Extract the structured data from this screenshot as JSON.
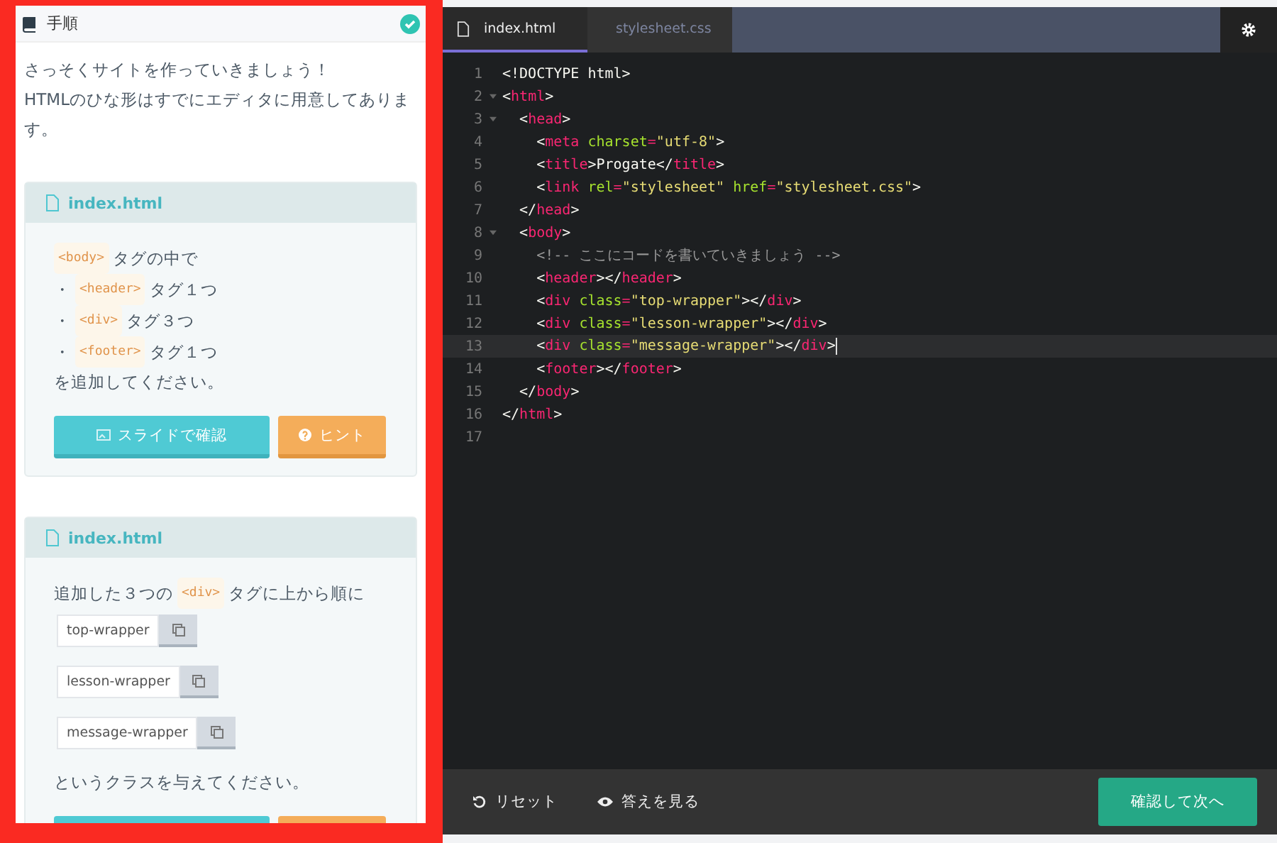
{
  "instructions": {
    "title": "手順",
    "completed": true,
    "intro": "さっそくサイトを作っていきましょう！\nHTMLのひな形はすでにエディタに用意してあります。",
    "cards": [
      {
        "file": "index.html",
        "lines": [
          [
            {
              "kind": "code",
              "text": "<body>"
            },
            {
              "kind": "text",
              "text": "タグの中で"
            }
          ],
          [
            {
              "kind": "text",
              "text": "・"
            },
            {
              "kind": "code",
              "text": "<header>"
            },
            {
              "kind": "text",
              "text": "タグ１つ"
            }
          ],
          [
            {
              "kind": "text",
              "text": "・"
            },
            {
              "kind": "code",
              "text": "<div>"
            },
            {
              "kind": "text",
              "text": "タグ３つ"
            }
          ],
          [
            {
              "kind": "text",
              "text": "・"
            },
            {
              "kind": "code",
              "text": "<footer>"
            },
            {
              "kind": "text",
              "text": "タグ１つ"
            }
          ],
          [
            {
              "kind": "text",
              "text": "を追加してください。"
            }
          ]
        ],
        "buttons": {
          "slide": "スライドで確認",
          "hint": "ヒント"
        }
      },
      {
        "file": "index.html",
        "lines": [
          [
            {
              "kind": "text",
              "text": "追加した３つの"
            },
            {
              "kind": "code",
              "text": "<div>"
            },
            {
              "kind": "text",
              "text": "タグに上から順に"
            }
          ]
        ],
        "copies": [
          "top-wrapper",
          "lesson-wrapper",
          "message-wrapper"
        ],
        "after": "というクラスを与えてください。"
      }
    ]
  },
  "editor": {
    "tabs": [
      {
        "label": "index.html",
        "selected": true
      },
      {
        "label": "stylesheet.css",
        "selected": false
      }
    ],
    "lines": [
      {
        "number": "1",
        "fold": false,
        "active": false,
        "tokens": [
          {
            "kind": "text",
            "text": "<!DOCTYPE html>"
          }
        ]
      },
      {
        "number": "2",
        "fold": true,
        "active": false,
        "tokens": [
          {
            "kind": "punct",
            "text": "<"
          },
          {
            "kind": "tag",
            "text": "html"
          },
          {
            "kind": "punct",
            "text": ">"
          }
        ]
      },
      {
        "number": "3",
        "fold": true,
        "active": false,
        "tokens": [
          {
            "kind": "punct",
            "text": "  <"
          },
          {
            "kind": "tag",
            "text": "head"
          },
          {
            "kind": "punct",
            "text": ">"
          }
        ]
      },
      {
        "number": "4",
        "fold": false,
        "active": false,
        "tokens": [
          {
            "kind": "punct",
            "text": "    <"
          },
          {
            "kind": "tag",
            "text": "meta"
          },
          {
            "kind": "attr",
            "text": " charset"
          },
          {
            "kind": "tag",
            "text": "="
          },
          {
            "kind": "str",
            "text": "\"utf-8\""
          },
          {
            "kind": "punct",
            "text": ">"
          }
        ]
      },
      {
        "number": "5",
        "fold": false,
        "active": false,
        "tokens": [
          {
            "kind": "punct",
            "text": "    <"
          },
          {
            "kind": "tag",
            "text": "title"
          },
          {
            "kind": "punct",
            "text": ">Progate</"
          },
          {
            "kind": "tag",
            "text": "title"
          },
          {
            "kind": "punct",
            "text": ">"
          }
        ]
      },
      {
        "number": "6",
        "fold": false,
        "active": false,
        "tokens": [
          {
            "kind": "punct",
            "text": "    <"
          },
          {
            "kind": "tag",
            "text": "link"
          },
          {
            "kind": "attr",
            "text": " rel"
          },
          {
            "kind": "tag",
            "text": "="
          },
          {
            "kind": "str",
            "text": "\"stylesheet\""
          },
          {
            "kind": "attr",
            "text": " href"
          },
          {
            "kind": "tag",
            "text": "="
          },
          {
            "kind": "str",
            "text": "\"stylesheet.css\""
          },
          {
            "kind": "punct",
            "text": ">"
          }
        ]
      },
      {
        "number": "7",
        "fold": false,
        "active": false,
        "tokens": [
          {
            "kind": "punct",
            "text": "  </"
          },
          {
            "kind": "tag",
            "text": "head"
          },
          {
            "kind": "punct",
            "text": ">"
          }
        ]
      },
      {
        "number": "8",
        "fold": true,
        "active": false,
        "tokens": [
          {
            "kind": "punct",
            "text": "  <"
          },
          {
            "kind": "tag",
            "text": "body"
          },
          {
            "kind": "punct",
            "text": ">"
          }
        ]
      },
      {
        "number": "9",
        "fold": false,
        "active": false,
        "tokens": [
          {
            "kind": "comment",
            "text": "    <!-- ここにコードを書いていきましょう -->"
          }
        ]
      },
      {
        "number": "10",
        "fold": false,
        "active": false,
        "tokens": [
          {
            "kind": "punct",
            "text": "    <"
          },
          {
            "kind": "tag",
            "text": "header"
          },
          {
            "kind": "punct",
            "text": "></"
          },
          {
            "kind": "tag",
            "text": "header"
          },
          {
            "kind": "punct",
            "text": ">"
          }
        ]
      },
      {
        "number": "11",
        "fold": false,
        "active": false,
        "tokens": [
          {
            "kind": "punct",
            "text": "    <"
          },
          {
            "kind": "tag",
            "text": "div"
          },
          {
            "kind": "attr",
            "text": " class"
          },
          {
            "kind": "tag",
            "text": "="
          },
          {
            "kind": "str",
            "text": "\"top-wrapper\""
          },
          {
            "kind": "punct",
            "text": "></"
          },
          {
            "kind": "tag",
            "text": "div"
          },
          {
            "kind": "punct",
            "text": ">"
          }
        ]
      },
      {
        "number": "12",
        "fold": false,
        "active": false,
        "tokens": [
          {
            "kind": "punct",
            "text": "    <"
          },
          {
            "kind": "tag",
            "text": "div"
          },
          {
            "kind": "attr",
            "text": " class"
          },
          {
            "kind": "tag",
            "text": "="
          },
          {
            "kind": "str",
            "text": "\"lesson-wrapper\""
          },
          {
            "kind": "punct",
            "text": "></"
          },
          {
            "kind": "tag",
            "text": "div"
          },
          {
            "kind": "punct",
            "text": ">"
          }
        ]
      },
      {
        "number": "13",
        "fold": false,
        "active": true,
        "tokens": [
          {
            "kind": "punct",
            "text": "    <"
          },
          {
            "kind": "tag",
            "text": "div"
          },
          {
            "kind": "attr",
            "text": " class"
          },
          {
            "kind": "tag",
            "text": "="
          },
          {
            "kind": "str",
            "text": "\"message-wrapper\""
          },
          {
            "kind": "punct",
            "text": "></"
          },
          {
            "kind": "tag",
            "text": "div"
          },
          {
            "kind": "punct",
            "text": ">"
          }
        ]
      },
      {
        "number": "14",
        "fold": false,
        "active": false,
        "tokens": [
          {
            "kind": "punct",
            "text": "    <"
          },
          {
            "kind": "tag",
            "text": "footer"
          },
          {
            "kind": "punct",
            "text": "></"
          },
          {
            "kind": "tag",
            "text": "footer"
          },
          {
            "kind": "punct",
            "text": ">"
          }
        ]
      },
      {
        "number": "15",
        "fold": false,
        "active": false,
        "tokens": [
          {
            "kind": "punct",
            "text": "  </"
          },
          {
            "kind": "tag",
            "text": "body"
          },
          {
            "kind": "punct",
            "text": ">"
          }
        ]
      },
      {
        "number": "16",
        "fold": false,
        "active": false,
        "tokens": [
          {
            "kind": "punct",
            "text": "</"
          },
          {
            "kind": "tag",
            "text": "html"
          },
          {
            "kind": "punct",
            "text": ">"
          }
        ]
      },
      {
        "number": "17",
        "fold": false,
        "active": false
      }
    ],
    "footer": {
      "reset": "リセット",
      "answer": "答えを見る",
      "next": "確認して次へ"
    }
  }
}
